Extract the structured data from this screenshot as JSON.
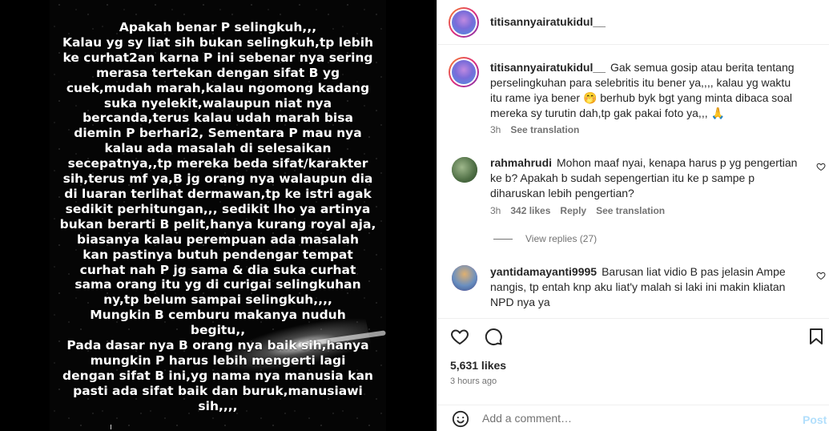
{
  "post": {
    "caption_lines": [
      "Apakah benar P selingkuh,,,",
      "Kalau yg sy liat sih bukan selingkuh,tp lebih",
      "ke curhat2an karna P ini sebenar nya sering",
      "merasa tertekan dengan sifat B yg",
      "cuek,mudah marah,kalau ngomong kadang",
      "suka nyelekit,walaupun niat nya",
      "bercanda,terus kalau udah marah bisa",
      "diemin P berhari2, Sementara P mau nya",
      "kalau ada masalah di selesaikan",
      "secepatnya,,tp mereka beda sifat/karakter",
      "sih,terus mf ya,B jg orang nya walaupun dia",
      "di luaran terlihat dermawan,tp ke istri agak",
      "sedikit perhitungan,,, sedikit lho ya artinya",
      "bukan berarti B pelit,hanya kurang royal aja,",
      "biasanya kalau perempuan ada masalah",
      "kan pastinya butuh pendengar tempat",
      "curhat nah P jg sama & dia suka curhat",
      "sama orang itu yg di curigai selingkuhan",
      "ny,tp belum sampai selingkuh,,,,",
      "Mungkin B cemburu makanya nuduh",
      "begitu,,",
      "Pada dasar nya B orang nya baik sih,hanya",
      "mungkin P harus lebih mengerti lagi",
      "dengan sifat B ini,yg nama nya manusia kan",
      "pasti ada sifat baik dan buruk,manusiawi",
      "sih,,,,"
    ],
    "corner_mark": "ı"
  },
  "header": {
    "username": "titisannyairatukidul__"
  },
  "comments": [
    {
      "username": "titisannyairatukidul__",
      "text": "Gak semua gosip atau berita tentang perselingkuhan para selebritis itu bener ya,,,, kalau yg waktu itu rame iya bener 🤭 berhub byk bgt yang minta dibaca soal mereka sy turutin dah,tp gak pakai foto ya,,, 🙏",
      "time": "3h",
      "translate": "See translation"
    },
    {
      "username": "rahmahrudi",
      "text": "Mohon maaf nyai, kenapa harus p yg pengertian ke b? Apakah b sudah sepengertian itu ke p sampe p diharuskan lebih pengertian?",
      "time": "3h",
      "likes": "342 likes",
      "reply": "Reply",
      "translate": "See translation",
      "view_replies": "View replies (27)"
    },
    {
      "username": "yantidamayanti9995",
      "text": "Barusan liat vidio B pas jelasin Ampe nangis, tp entah knp aku liat'y malah si laki ini makin kliatan NPD nya ya"
    }
  ],
  "footer": {
    "likes": "5,631 likes",
    "time": "3 hours ago",
    "comment_placeholder": "Add a comment…",
    "post_label": "Post"
  },
  "colors": {
    "accent": "#0095f6",
    "post_disabled": "#b2dffc",
    "text": "#262626",
    "muted": "#737373"
  }
}
